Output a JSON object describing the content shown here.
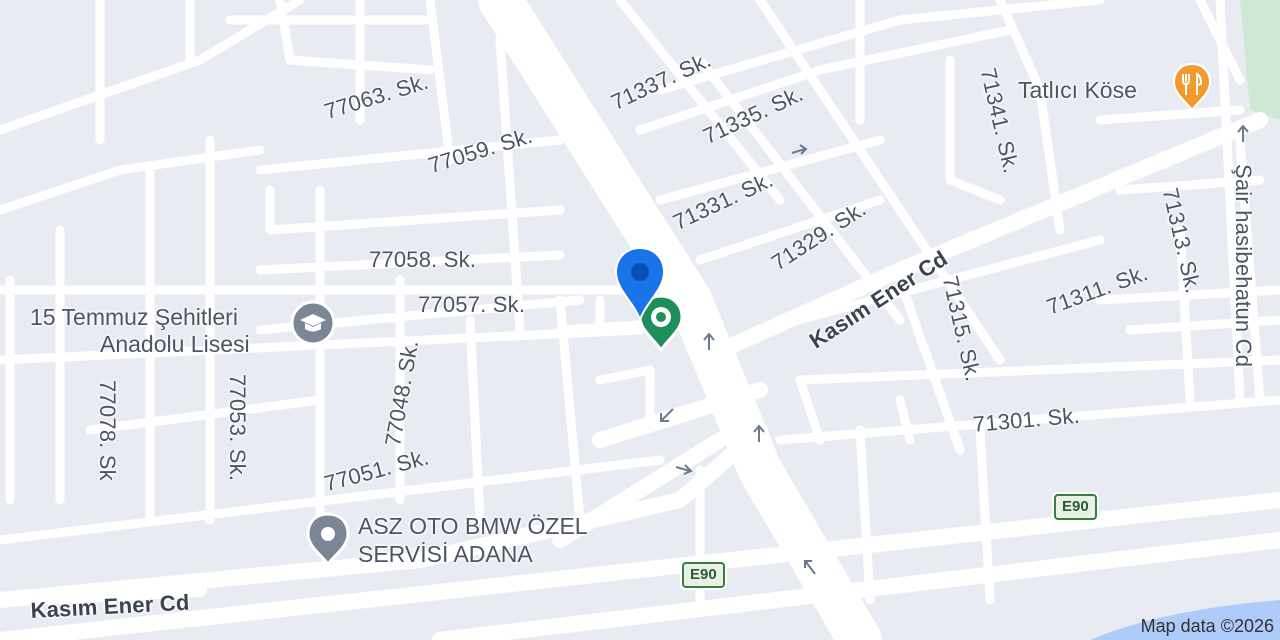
{
  "map": {
    "colors": {
      "land": "#e9ebf2",
      "road": "#ffffff",
      "highway": "#ffffff",
      "label": "#4d5563",
      "accent_blue": "#1a73e8",
      "poi_green": "#1e8e5c",
      "food_orange": "#f29a2e",
      "generic_poi": "#7b8794"
    },
    "streets": {
      "s77063": "77063. Sk.",
      "s77059": "77059. Sk.",
      "s71337": "71337. Sk.",
      "s71335": "71335. Sk.",
      "s71341": "71341. Sk.",
      "s71331": "71331. Sk.",
      "s71329": "71329. Sk.",
      "s77058": "77058. Sk.",
      "s77057": "77057. Sk.",
      "kasim_ener_upper": "Kasım Ener Cd",
      "s71315": "71315. Sk.",
      "s71311": "71311. Sk.",
      "s71313": "71313. Sk.",
      "sair": "Şair hasibehatun Cd",
      "s71301": "71301. Sk.",
      "s77048": "77048. Sk.",
      "s77078": "77078. Sk",
      "s77053": "77053. Sk.",
      "s77051": "77051. Sk.",
      "kasim_ener_lower": "Kasım Ener Cd"
    },
    "pois": {
      "tatlici": "Tatlıcı Köse",
      "school_line1": "15 Temmuz Şehitleri",
      "school_line2": "Anadolu Lisesi",
      "service_line1": "ASZ OTO BMW ÖZEL",
      "service_line2": "SERVİSİ ADANA"
    },
    "shields": {
      "e90_right": "E90",
      "e90_center": "E90"
    },
    "attribution": "Map data ©2026",
    "icons": [
      "restaurant-icon",
      "school-icon",
      "place-icon",
      "location-pin-icon",
      "selected-place-marker-icon",
      "one-way-arrow-icon"
    ]
  }
}
